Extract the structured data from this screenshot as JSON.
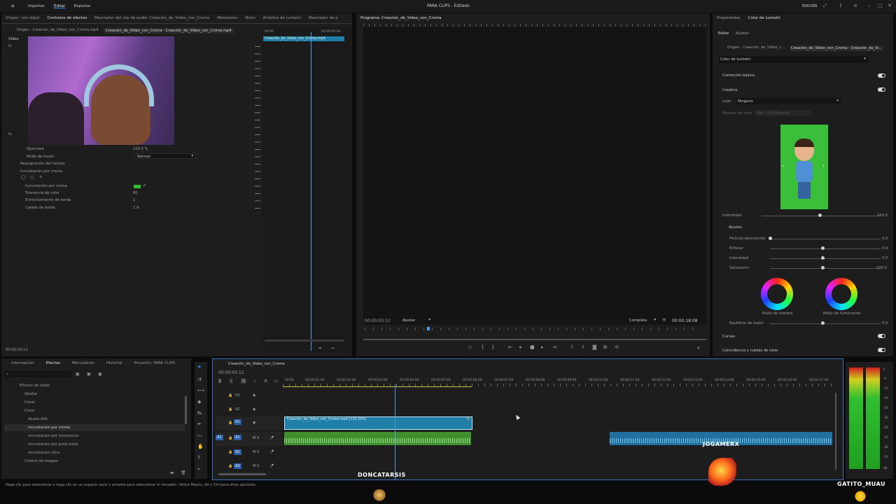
{
  "topbar": {
    "menu": [
      "Importar",
      "Editar",
      "Exportar"
    ],
    "active_menu": "Editar",
    "title": "PARA CLIPS - Editado",
    "edition": "EDICIÓN"
  },
  "source_tabs": [
    "Origen: (sin clips)",
    "Controles de efectos",
    "Mezclador del clip de audio: Creación_de_Video_con_Croma",
    "Metadatos",
    "Texto",
    "Ámbitos de Lumetri",
    "Mezclador de p"
  ],
  "effect_controls": {
    "master_clip": "Origen - Creación_de_Video_con_Croma.mp4",
    "seq_clip": "Creación_de_Video_con_Croma - Creación_de_Video_con_Croma.mp4",
    "video_label": "Vídeo",
    "opacity_label": "Opacidad",
    "opacity_value": "100.0 %",
    "blend_label": "Modo de fusión",
    "blend_value": "Normal",
    "remap_label": "Reasignación del tiempo",
    "keying_label": "Incrustación por croma",
    "key_color_label": "Incrustación por croma",
    "tolerance_label": "Tolerancia de color",
    "tolerance_value": "80",
    "edge_thin_label": "Estrechamiento de borde",
    "edge_thin_value": "1",
    "feather_label": "Calado de borde",
    "feather_value": "1.9",
    "mini_tl_start": "00:00",
    "mini_tl_end": "00:00:05:00",
    "mini_clip": "Creación_de_Video_con_Croma.mp4",
    "timecode": "00:00:03:12"
  },
  "program": {
    "title": "Programa: Creación_de_Video_con_Croma",
    "timecode": "00:00:03:12",
    "fit": "Ajustar",
    "quality": "Completa",
    "duration": "00:00:18:08"
  },
  "lumetri": {
    "tabs": [
      "Propiedades",
      "Color de Lumetri"
    ],
    "subtabs": [
      "Editar",
      "Ajustes"
    ],
    "master": "Origen - Creación_de_Video_c...",
    "seq": "Creación_de_Video_con_Croma - Creación_de_Vi...",
    "effect": "Color de Lumetri",
    "basic": "Corrección básica",
    "creative": "Creativo",
    "look_label": "Look",
    "look_value": "Ninguno",
    "space_label": "Espacio de color",
    "space_value": "Rec. 709 (Escena)",
    "intensity_label": "Intensidad",
    "intensity_value": "100.0",
    "adjust_label": "Ajustes",
    "faded_label": "Película descolorida",
    "faded_value": "0.0",
    "sharpen_label": "Enfocar",
    "sharpen_value": "0.0",
    "vibrance_label": "Intensidad",
    "vibrance_value": "0.0",
    "saturation_label": "Saturación",
    "saturation_value": "100.0",
    "shadow_tint": "Matiz de sombra",
    "highlight_tint": "Matiz de iluminación",
    "tint_balance_label": "Equilibrio de matiz",
    "tint_balance_value": "0.0",
    "curves": "Curvas",
    "color_wheels": "Coincidencia y ruedas de color"
  },
  "project": {
    "tabs": [
      "Información",
      "Efectos",
      "Marcadores",
      "Historial",
      "Proyecto: PARA CLIPS"
    ],
    "active": "Efectos",
    "tree": [
      "Efectos de vídeo",
      "Ajustar",
      "Canal",
      "Clave",
      "Ajuste Alfa",
      "Incrustación por croma",
      "Incrustación por luminancia",
      "Incrustación por pista mate",
      "Incrustación ultra",
      "Control de imagen"
    ]
  },
  "timeline": {
    "title": "Creación_de_Video_con_Croma",
    "timecode": "00:00:03:12",
    "ruler": [
      "00:00",
      "00:00:01:00",
      "00:00:02:00",
      "00:00:03:00",
      "00:00:04:00",
      "00:00:05:00",
      "00:00:06:00",
      "00:00:07:00",
      "00:00:08:00",
      "00:00:09:00",
      "00:00:10:00",
      "00:00:11:00",
      "00:00:12:00",
      "00:00:13:00",
      "00:00:14:00",
      "00:00:15:00",
      "00:00:16:00",
      "00:00:17:00"
    ],
    "tracks": [
      "V3",
      "V2",
      "V1",
      "A1",
      "A2",
      "A3"
    ],
    "video_clip": "Creación_de_Video_con_Croma.mp4 [133.33%]",
    "audio_mark": "M S"
  },
  "meter_scale": [
    "0",
    "-6",
    "-12",
    "-18",
    "-24",
    "-30",
    "-36",
    "-42",
    "-48",
    "-54",
    "dB"
  ],
  "statusbar": "Haga clic para seleccionar o haga clic en un espacio vacío y arrastre para seleccionar el recuadro. Utilice Mayús, Alt y Ctrl para otras opciones.",
  "overlays": [
    "DONCATARSIS",
    "JOGAMERX",
    "GATITO_MUAU"
  ],
  "colors": {
    "accent": "#2f8fff",
    "video_clip": "#1f7fa6",
    "audio_clip": "#3f8f2f",
    "keyed_green": "#2fc12f"
  }
}
